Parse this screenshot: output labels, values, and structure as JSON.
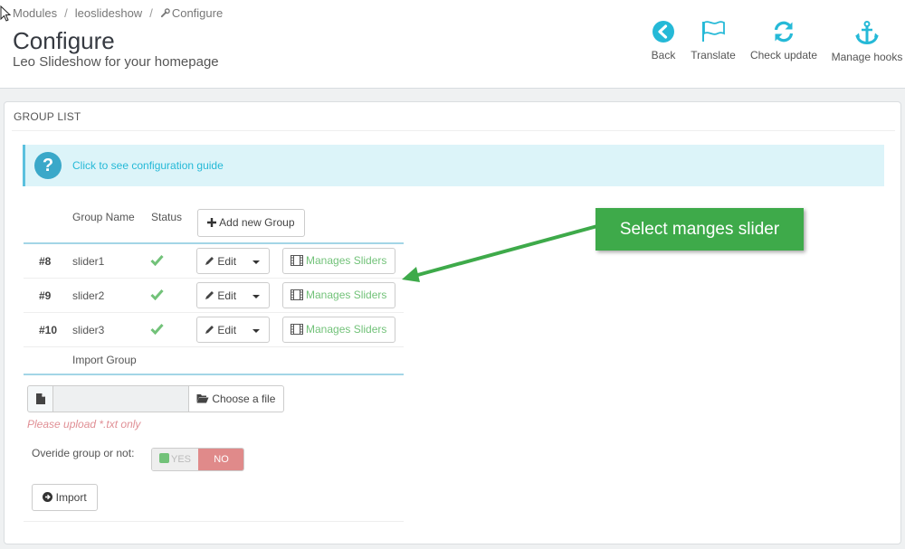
{
  "breadcrumb": {
    "modules": "Modules",
    "leoslideshow": "leoslideshow",
    "configure": "Configure"
  },
  "header": {
    "title": "Configure",
    "subtitle": "Leo Slideshow for your homepage"
  },
  "toolbar": {
    "back": "Back",
    "translate": "Translate",
    "check_update": "Check update",
    "manage_hooks": "Manage hooks"
  },
  "panel": {
    "heading": "GROUP LIST"
  },
  "info": {
    "link": "Click to see configuration guide"
  },
  "table": {
    "headers": {
      "group_name": "Group Name",
      "status": "Status"
    },
    "add_group": "Add new Group",
    "rows": [
      {
        "id": "#8",
        "name": "slider1",
        "edit": "Edit",
        "manage": "Manages Sliders"
      },
      {
        "id": "#9",
        "name": "slider2",
        "edit": "Edit",
        "manage": "Manages Sliders"
      },
      {
        "id": "#10",
        "name": "slider3",
        "edit": "Edit",
        "manage": "Manages Sliders"
      }
    ]
  },
  "import": {
    "label": "Import Group",
    "choose_file": "Choose a file",
    "warning": "Please upload *.txt only",
    "override_label": "Overide group or not:",
    "yes": "YES",
    "no": "NO",
    "import_button": "Import"
  },
  "callout": {
    "text": "Select manges slider"
  },
  "colors": {
    "accent": "#25b9d7",
    "success": "#72c279",
    "danger": "#e08a8a",
    "callout": "#3eaa4a"
  }
}
